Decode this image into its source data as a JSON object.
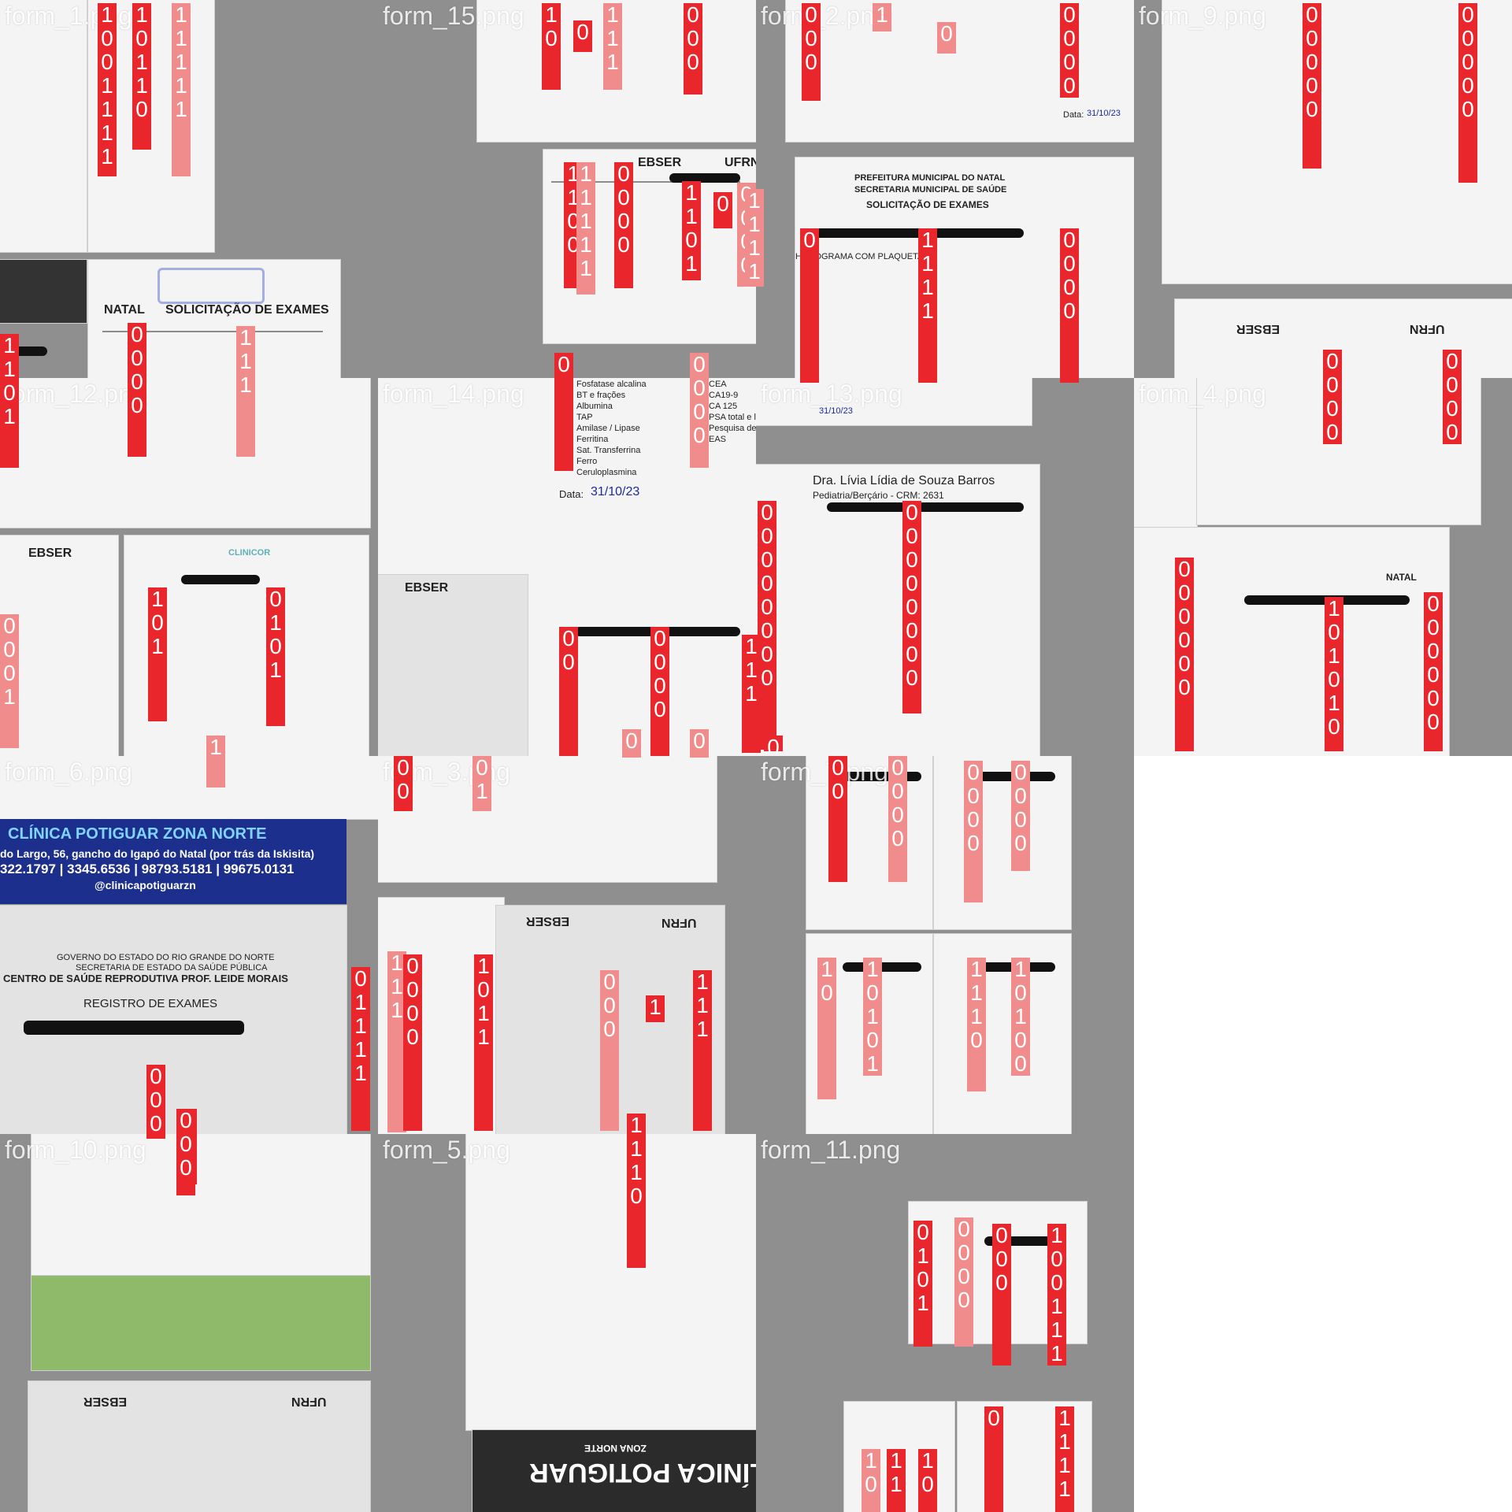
{
  "tiles": [
    {
      "label": "form_1.png"
    },
    {
      "label": "form_15.png"
    },
    {
      "label": "form_2.png"
    },
    {
      "label": "form_9.png"
    },
    {
      "label": "form_12.png"
    },
    {
      "label": "form_14.png"
    },
    {
      "label": "form_13.png"
    },
    {
      "label": "form_4.png"
    },
    {
      "label": "form_6.png"
    },
    {
      "label": "form_3.png"
    },
    {
      "label": "form_7.png"
    },
    {
      "label": "form_10.png"
    },
    {
      "label": "form_5.png"
    },
    {
      "label": "form_11.png"
    }
  ],
  "documents": {
    "natal_title": "NATAL",
    "solicitacao": "SOLICITAÇÃO DE EXAMES",
    "prefeitura": "PREFEITURA MUNICIPAL DO NATAL",
    "secretaria": "SECRETARIA MUNICIPAL DE SAÚDE",
    "ebserh": "EBSER",
    "ufrn": "UFRN",
    "clinicor": "CLINICOR",
    "dra_name": "Dra. Lívia Lídia de Souza Barros",
    "dra_sub": "Pediatria/Berçário - CRM: 2631",
    "clinica_pot": "CLÍNICA POTIGUAR ZONA NORTE",
    "clinica_pot_addr": "do Largo, 56, gancho do Igapó do Natal (por trás da Iskisita)",
    "clinica_pot_phone": "322.1797 | 3345.6536 | 98793.5181 | 99675.0131",
    "clinica_pot_insta": "@clinicapotiguarzn",
    "governo": "GOVERNO DO ESTADO DO RIO GRANDE DO NORTE",
    "sesap": "SECRETARIA DE ESTADO DA SAÚDE PÚBLICA",
    "centro": "CENTRO DE SAÚDE REPRODUTIVA PROF. LEIDE MORAIS",
    "registro": "REGISTRO DE EXAMES",
    "clinica_logo": "CLÍNICA POTIGUAR",
    "zona_norte": "ZONA NORTE",
    "data_label": "Data:",
    "data_value": "31/10/23",
    "hemograma": "HEMOGRAMA COM PLAQUETAS",
    "exams_list": [
      "Fosfatase alcalina",
      "BT e frações",
      "Albumina",
      "TAP",
      "Amilase / Lipase",
      "Ferritina",
      "Sat. Transferrina",
      "Ferro",
      "Ceruloplasmina"
    ],
    "exams_list_b": [
      "CEA",
      "CA19-9",
      "CA 125",
      "PSA total e livre",
      "Pesquisa de s",
      "EAS"
    ]
  },
  "bars": [
    {
      "digits": "1001111"
    },
    {
      "digits": "10110"
    },
    {
      "digits": "11111"
    },
    {
      "digits": "10"
    },
    {
      "digits": "0"
    },
    {
      "digits": "1111"
    },
    {
      "digits": "000"
    },
    {
      "digits": "000"
    },
    {
      "digits": "1"
    },
    {
      "digits": "00"
    },
    {
      "digits": "00000"
    },
    {
      "digits": "00000"
    },
    {
      "digits": "1100"
    },
    {
      "digits": "0000"
    },
    {
      "digits": "11111"
    },
    {
      "digits": "11011"
    },
    {
      "digits": "0000"
    },
    {
      "digits": "0101"
    },
    {
      "digits": "1111"
    },
    {
      "digits": "0"
    },
    {
      "digits": "1111"
    },
    {
      "digits": "0000"
    },
    {
      "digits": "0000"
    },
    {
      "digits": "00000"
    },
    {
      "digits": "1101"
    },
    {
      "digits": "0001"
    },
    {
      "digits": "0000"
    },
    {
      "digits": "111"
    },
    {
      "digits": "101"
    },
    {
      "digits": "0101"
    },
    {
      "digits": "0"
    },
    {
      "digits": "0000"
    },
    {
      "digits": "00"
    },
    {
      "digits": "0000"
    },
    {
      "digits": "00000"
    },
    {
      "digits": "00000"
    },
    {
      "digits": "111"
    },
    {
      "digits": "1101"
    },
    {
      "digits": "000"
    },
    {
      "digits": "0"
    },
    {
      "digits": "1010"
    },
    {
      "digits": "00000000"
    },
    {
      "digits": "00000000"
    },
    {
      "digits": "0000"
    },
    {
      "digits": "0101"
    },
    {
      "digits": "11111"
    },
    {
      "digits": "0"
    },
    {
      "digits": "1101"
    },
    {
      "digits": "000000"
    },
    {
      "digits": "101010"
    },
    {
      "digits": "000000"
    },
    {
      "digits": "1"
    },
    {
      "digits": "10"
    },
    {
      "digits": "1"
    },
    {
      "digits": "0000000"
    },
    {
      "digits": "10101"
    },
    {
      "digits": "00000"
    },
    {
      "digits": "1111"
    },
    {
      "digits": "0000"
    },
    {
      "digits": "00000"
    },
    {
      "digits": "01111"
    },
    {
      "digits": "00000"
    },
    {
      "digits": "111"
    },
    {
      "digits": "000"
    },
    {
      "digits": "0000"
    },
    {
      "digits": "1011"
    },
    {
      "digits": "000"
    },
    {
      "digits": "111"
    },
    {
      "digits": "1111"
    },
    {
      "digits": "0101"
    },
    {
      "digits": "00"
    },
    {
      "digits": "0000"
    },
    {
      "digits": "0000"
    },
    {
      "digits": "0000"
    },
    {
      "digits": "10"
    },
    {
      "digits": "10101"
    },
    {
      "digits": "1110"
    },
    {
      "digits": "10100"
    },
    {
      "digits": "000"
    },
    {
      "digits": "1110"
    },
    {
      "digits": "0101"
    },
    {
      "digits": "0000"
    },
    {
      "digits": "000"
    }
  ],
  "colors": {
    "red": "#e8262c",
    "pink": "#f08c8c",
    "gray": "#8f8f8f"
  }
}
